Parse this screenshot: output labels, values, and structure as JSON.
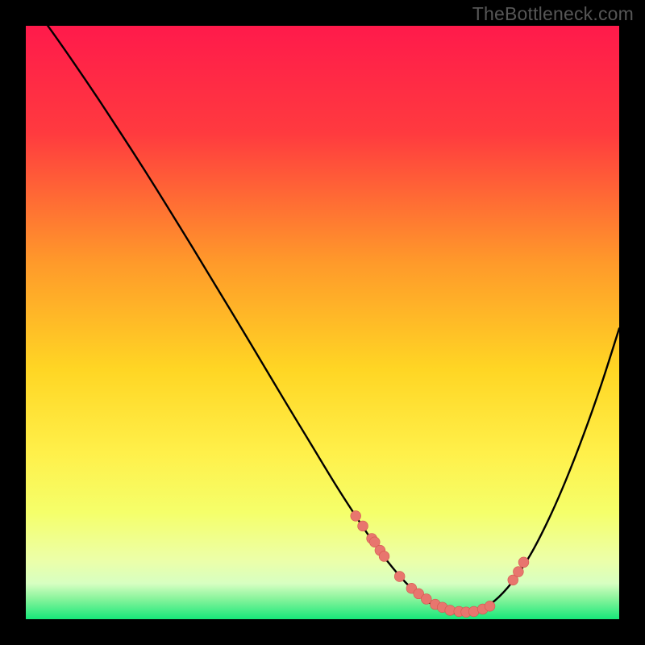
{
  "watermark": "TheBottleneck.com",
  "colors": {
    "background": "#000000",
    "gradient_top": "#ff1a4b",
    "gradient_mid_upper": "#ff7a2a",
    "gradient_mid": "#ffd624",
    "gradient_lower": "#f5ff5a",
    "gradient_pale": "#f8ffb7",
    "gradient_bottom": "#17e879",
    "curve": "#000000",
    "marker_fill": "#e8766e",
    "marker_stroke": "#d4564f"
  },
  "chart_data": {
    "type": "line",
    "title": "",
    "xlabel": "",
    "ylabel": "",
    "xlim": [
      0,
      100
    ],
    "ylim": [
      0,
      100
    ],
    "gradient_stops": [
      {
        "offset": 0.0,
        "color": "#ff1a4b"
      },
      {
        "offset": 0.18,
        "color": "#ff3a3f"
      },
      {
        "offset": 0.4,
        "color": "#ff9a2a"
      },
      {
        "offset": 0.58,
        "color": "#ffd624"
      },
      {
        "offset": 0.72,
        "color": "#fff04a"
      },
      {
        "offset": 0.82,
        "color": "#f5ff6a"
      },
      {
        "offset": 0.9,
        "color": "#ecffa8"
      },
      {
        "offset": 0.94,
        "color": "#d7ffc1"
      },
      {
        "offset": 0.965,
        "color": "#8af49d"
      },
      {
        "offset": 1.0,
        "color": "#17e879"
      }
    ],
    "series": [
      {
        "name": "bottleneck-curve",
        "x": [
          0,
          4,
          8,
          12,
          16,
          20,
          24,
          28,
          32,
          36,
          40,
          44,
          48,
          52,
          55,
          58,
          61,
          64,
          67,
          70,
          73,
          76,
          79,
          82,
          85,
          88,
          91,
          94,
          97,
          100
        ],
        "y": [
          105,
          99.6,
          93.9,
          88.0,
          81.9,
          75.7,
          69.3,
          62.8,
          56.2,
          49.6,
          42.9,
          36.2,
          29.6,
          23.0,
          18.3,
          13.8,
          9.7,
          6.2,
          3.5,
          1.7,
          0.9,
          1.3,
          3.1,
          6.3,
          10.8,
          16.6,
          23.4,
          31.1,
          39.6,
          49.0
        ]
      }
    ],
    "markers": {
      "name": "highlight-points",
      "x": [
        55.6,
        56.8,
        58.3,
        58.8,
        59.7,
        60.4,
        63.0,
        65.0,
        66.2,
        67.5,
        69.0,
        70.2,
        71.5,
        73.0,
        74.2,
        75.5,
        77.0,
        78.2,
        82.1,
        83.0,
        83.9
      ],
      "y": [
        17.4,
        15.7,
        13.6,
        13.0,
        11.6,
        10.6,
        7.2,
        5.2,
        4.3,
        3.4,
        2.5,
        2.0,
        1.5,
        1.3,
        1.2,
        1.3,
        1.7,
        2.2,
        6.6,
        8.0,
        9.6
      ]
    }
  }
}
